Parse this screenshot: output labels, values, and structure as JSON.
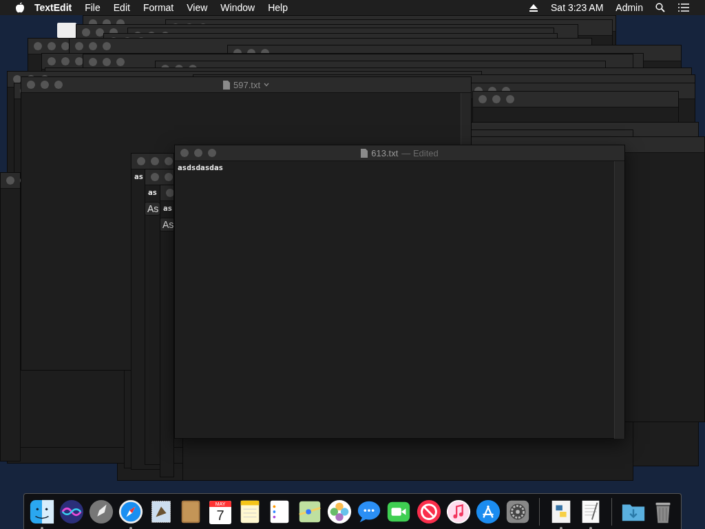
{
  "menubar": {
    "app_name": "TextEdit",
    "menus": [
      "File",
      "Edit",
      "Format",
      "View",
      "Window",
      "Help"
    ],
    "clock": "Sat 3:23 AM",
    "user": "Admin"
  },
  "fragment_windows": [
    {
      "text": "as"
    },
    {
      "text": "as",
      "button": "As"
    },
    {
      "text": "as",
      "button": "As"
    }
  ],
  "windows": [
    {
      "title": "597.txt",
      "active": false
    },
    {
      "title": "613.txt",
      "edited": "— Edited",
      "active": true,
      "text": "asdsdasdas"
    }
  ],
  "dock": {
    "items": [
      {
        "kind": "finder",
        "running": true
      },
      {
        "kind": "siri",
        "running": false
      },
      {
        "kind": "launchpad",
        "running": false
      },
      {
        "kind": "safari",
        "running": true
      },
      {
        "kind": "mail",
        "running": false
      },
      {
        "kind": "contacts",
        "running": false
      },
      {
        "kind": "calendar",
        "running": false,
        "month": "MAY",
        "day": "7"
      },
      {
        "kind": "notes",
        "running": false
      },
      {
        "kind": "reminders",
        "running": false
      },
      {
        "kind": "maps",
        "running": false
      },
      {
        "kind": "photos",
        "running": false
      },
      {
        "kind": "messages",
        "running": false
      },
      {
        "kind": "facetime",
        "running": false
      },
      {
        "kind": "news",
        "running": false
      },
      {
        "kind": "music",
        "running": false
      },
      {
        "kind": "appstore",
        "running": false
      },
      {
        "kind": "settings",
        "running": false
      },
      {
        "kind": "separator",
        "running": false
      },
      {
        "kind": "python",
        "running": true
      },
      {
        "kind": "textedit",
        "running": true
      },
      {
        "kind": "separator",
        "running": false
      },
      {
        "kind": "downloads",
        "running": false
      },
      {
        "kind": "trash",
        "running": false
      }
    ]
  }
}
